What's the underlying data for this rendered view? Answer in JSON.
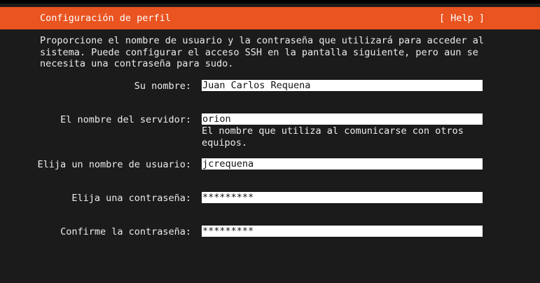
{
  "header": {
    "title": "Configuración de perfil",
    "help_label": "[ Help ]"
  },
  "intro": {
    "lines": [
      "Proporcione el nombre de usuario y la contraseña que utilizará para acceder al",
      "sistema. Puede configurar el acceso SSH en la pantalla siguiente, pero aun se",
      "necesita una contraseña para sudo."
    ]
  },
  "form": {
    "name": {
      "label": "Su nombre:",
      "value": "Juan Carlos Requena"
    },
    "hostname": {
      "label": "El nombre del servidor:",
      "value": "orion",
      "hint_lines": [
        "El nombre que utiliza al comunicarse con otros",
        "equipos."
      ]
    },
    "username": {
      "label": "Elija un nombre de usuario:",
      "value": "jcrequena"
    },
    "password": {
      "label": "Elija una contraseña:",
      "value": "*********"
    },
    "confirm_password": {
      "label": "Confirme la contraseña:",
      "value": "*********"
    }
  },
  "colors": {
    "accent": "#e95420",
    "background": "#1b1b1b",
    "field_background": "#ffffff"
  }
}
